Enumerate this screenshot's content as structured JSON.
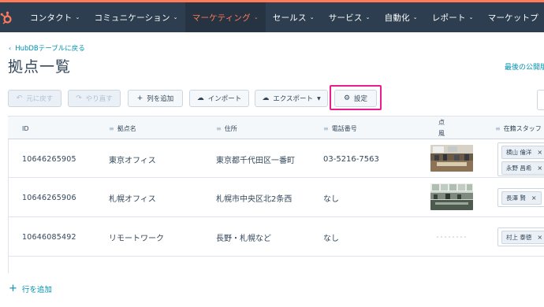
{
  "nav": {
    "items": [
      {
        "label": "コンタクト"
      },
      {
        "label": "コミュニケーション"
      },
      {
        "label": "マーケティング"
      },
      {
        "label": "セールス"
      },
      {
        "label": "サービス"
      },
      {
        "label": "自動化"
      },
      {
        "label": "レポート"
      },
      {
        "label": "マーケットプ"
      }
    ],
    "active_index": 2,
    "colors": {
      "bar": "#2d3e50",
      "accent": "#ff7a59",
      "active_bg": "#253342"
    }
  },
  "back_link": "HubDBテーブルに戻る",
  "page_title": "拠点一覧",
  "last_publish_link": "最後の公開版",
  "toolbar": {
    "undo": "元に戻す",
    "redo": "やり直す",
    "add_column": "列を追加",
    "import": "インポート",
    "export": "エクスポート",
    "settings": "設定"
  },
  "highlight_color": "#e91e8c",
  "table": {
    "columns": {
      "id": "ID",
      "name": "拠点名",
      "address": "住所",
      "phone": "電話番号",
      "photo_line1": "点",
      "photo_line2": "風",
      "staff": "在籍スタッフ"
    },
    "rows": [
      {
        "id": "10646265905",
        "name": "東京オフィス",
        "address": "東京都千代田区一番町",
        "phone": "03-5216-7563",
        "photo": "office-photo-1",
        "staff": [
          "横山 倫洋",
          "永野 昌希"
        ]
      },
      {
        "id": "10646265906",
        "name": "札幌オフィス",
        "address": "札幌市中央区北2条西",
        "phone": "なし",
        "photo": "office-photo-2",
        "staff": [
          "長澤 賢"
        ]
      },
      {
        "id": "10646085492",
        "name": "リモートワーク",
        "address": "長野・札幌など",
        "phone": "なし",
        "photo": "none",
        "staff": [
          "村上 泰徳"
        ]
      }
    ]
  },
  "add_row": "行を追加",
  "icons": {
    "logo": "hubspot-sprocket-icon",
    "undo": "undo-icon",
    "redo": "redo-icon",
    "add": "plus-icon",
    "import": "cloud-upload-icon",
    "export": "cloud-download-icon",
    "settings": "gear-icon"
  }
}
